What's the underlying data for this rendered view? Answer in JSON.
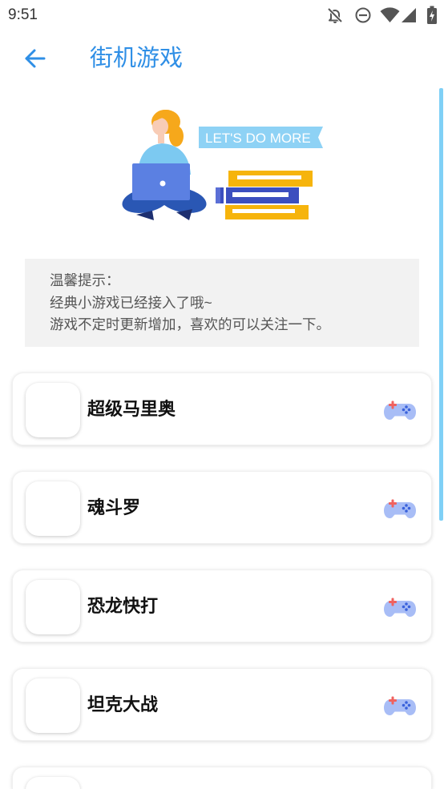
{
  "status_bar": {
    "time": "9:51",
    "icons": [
      "notifications-off-icon",
      "do-not-disturb-icon",
      "wifi-icon",
      "signal-icon",
      "battery-charging-icon"
    ]
  },
  "header": {
    "back_icon": "arrow-left-icon",
    "title": "街机游戏"
  },
  "illustration": {
    "banner_text": "LET'S DO MORE"
  },
  "tip": {
    "title": "温馨提示：",
    "lines": [
      "经典小游戏已经接入了哦~",
      "游戏不定时更新增加，喜欢的可以关注一下。"
    ]
  },
  "games": [
    {
      "name": "超级马里奥",
      "icon": "gamepad-icon"
    },
    {
      "name": "魂斗罗",
      "icon": "gamepad-icon"
    },
    {
      "name": "恐龙快打",
      "icon": "gamepad-icon"
    },
    {
      "name": "坦克大战",
      "icon": "gamepad-icon"
    }
  ],
  "colors": {
    "accent": "#2f8fe6",
    "tip_background": "#f2f2f2",
    "tip_text": "#555555",
    "banner": "#8ed2f5",
    "scrollbar": "#7fd0f6",
    "book_yellow": "#f6b40c",
    "book_blue": "#3c4fbf"
  }
}
